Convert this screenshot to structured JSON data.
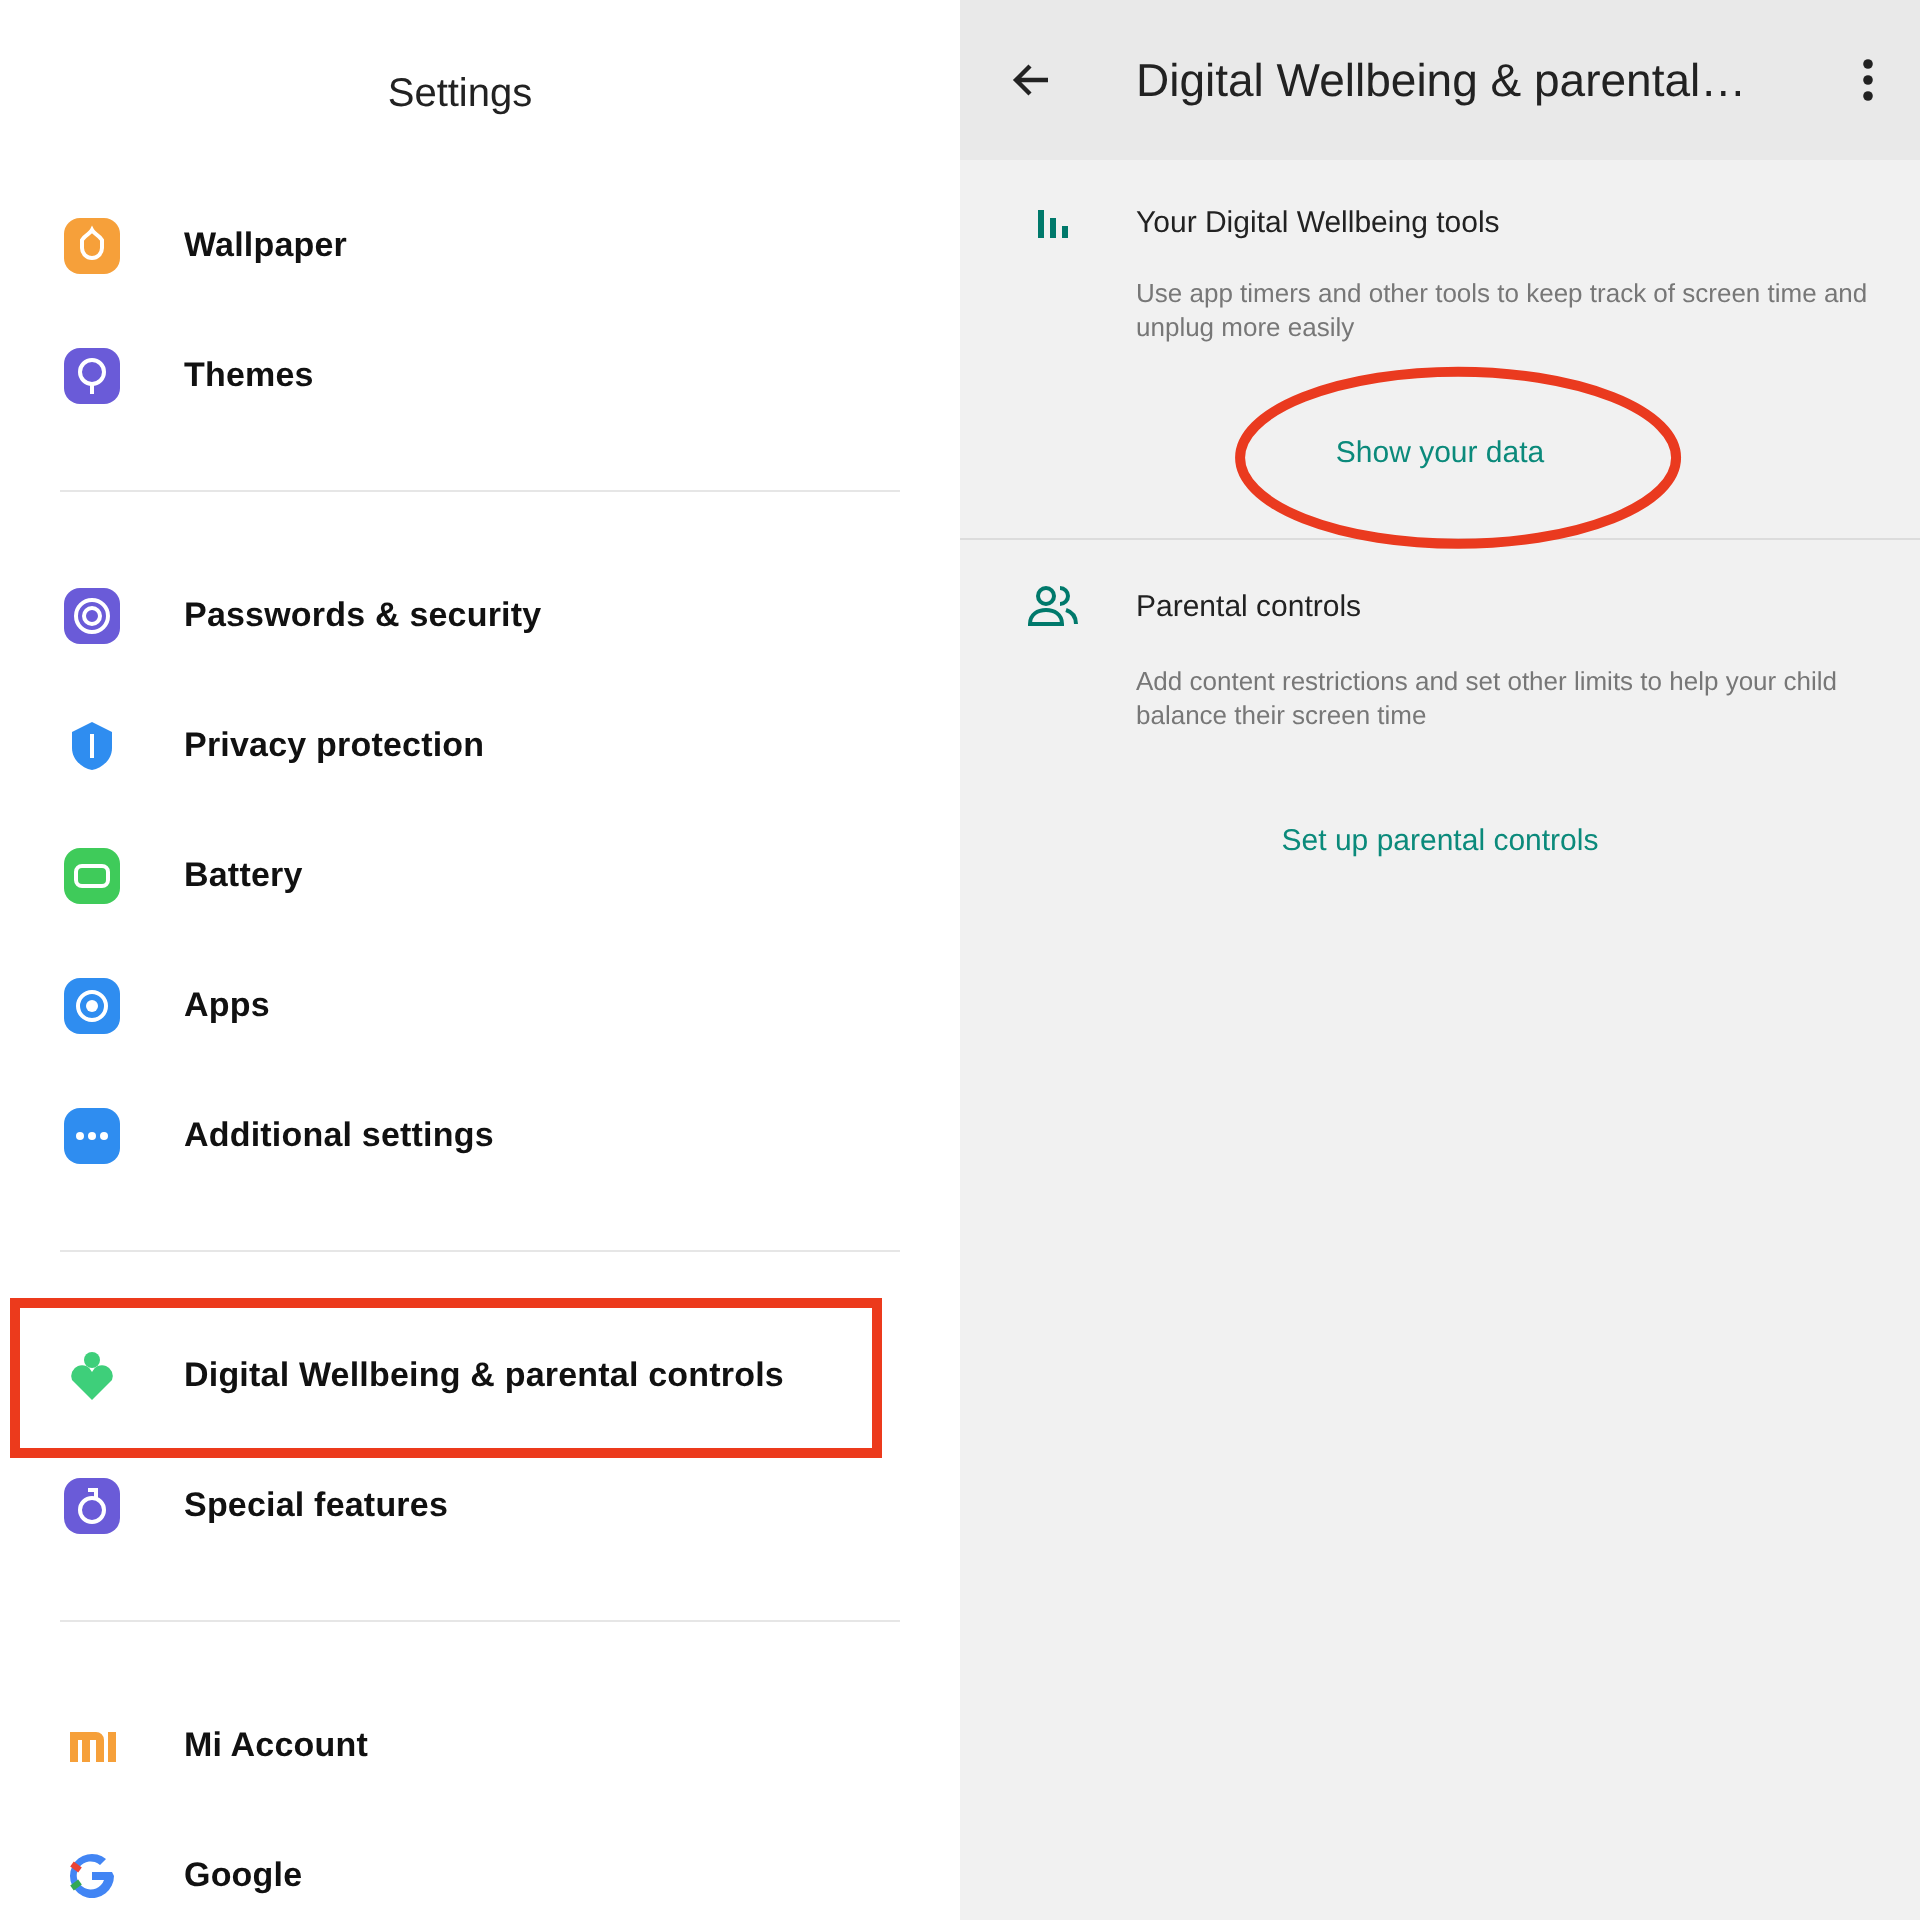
{
  "settings": {
    "title": "Settings",
    "groups": [
      {
        "items": [
          {
            "label": "Wallpaper",
            "kind": "flower",
            "color": "#f6a03a",
            "highlighted": false
          },
          {
            "label": "Themes",
            "kind": "balloon",
            "color": "#6a5bd8",
            "highlighted": false
          }
        ]
      },
      {
        "items": [
          {
            "label": "Passwords & security",
            "kind": "fingerprint",
            "color": "#6a5bd8",
            "highlighted": false
          },
          {
            "label": "Privacy protection",
            "kind": "shield",
            "color": "#2f8df0",
            "highlighted": false
          },
          {
            "label": "Battery",
            "kind": "battery",
            "color": "#3fcb5a",
            "highlighted": false
          },
          {
            "label": "Apps",
            "kind": "gear",
            "color": "#2f8df0",
            "highlighted": false
          },
          {
            "label": "Additional settings",
            "kind": "dots",
            "color": "#2f8df0",
            "highlighted": false
          }
        ]
      },
      {
        "items": [
          {
            "label": "Digital Wellbeing & parental controls",
            "kind": "heart",
            "color": "#3ecf7a",
            "highlighted": true
          },
          {
            "label": "Special features",
            "kind": "flask",
            "color": "#6a5bd8",
            "highlighted": false
          }
        ]
      },
      {
        "items": [
          {
            "label": "Mi Account",
            "kind": "mi",
            "color": "#f6a03a",
            "highlighted": false
          },
          {
            "label": "Google",
            "kind": "google",
            "color": "#4285f4",
            "highlighted": false
          }
        ]
      }
    ]
  },
  "wellbeing": {
    "title": "Digital Wellbeing & parental…",
    "sections": [
      {
        "kind": "chart",
        "title": "Your Digital Wellbeing tools",
        "description": "Use app timers and other tools to keep track of screen time and unplug more easily",
        "link": "Show your data",
        "highlighted": true
      },
      {
        "kind": "people",
        "title": "Parental controls",
        "description": "Add content restrictions and set other limits to help your child balance their screen time",
        "link": "Set up parental controls",
        "highlighted": false
      }
    ]
  }
}
